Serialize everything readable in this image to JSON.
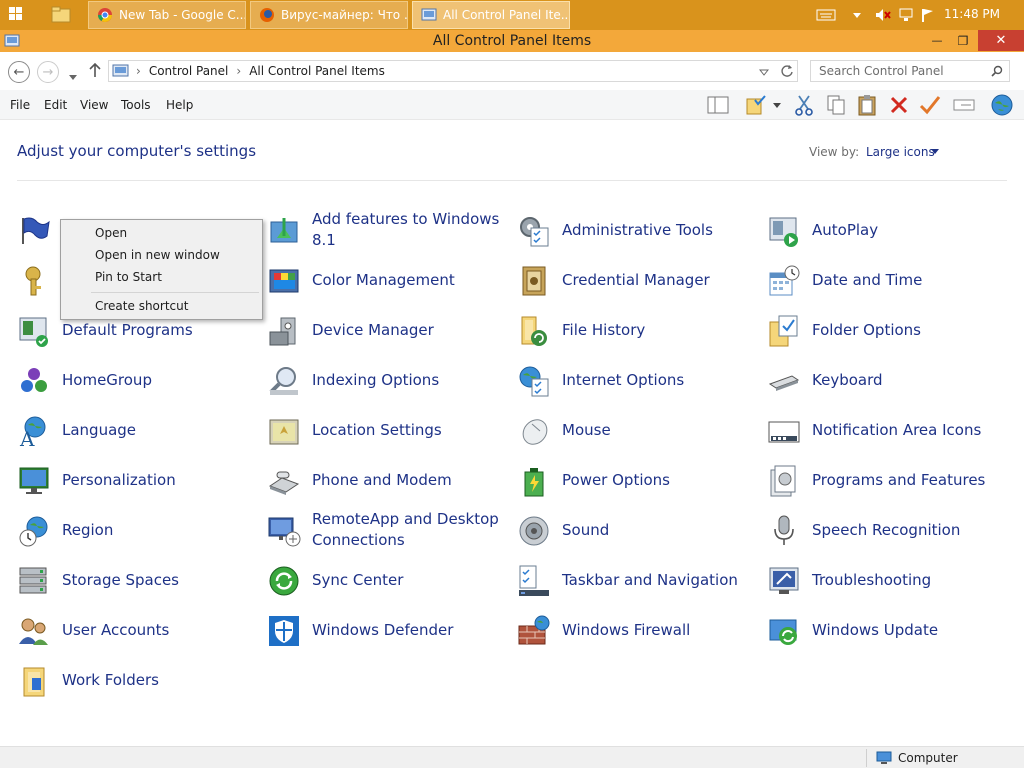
{
  "taskbar": {
    "tabs": [
      {
        "label": "New Tab - Google C...",
        "icon": "chrome-icon"
      },
      {
        "label": "Вирус-майнер: Что ...",
        "icon": "firefox-icon"
      },
      {
        "label": "All Control Panel Ite...",
        "icon": "control-panel-icon"
      }
    ],
    "clock": "11:48 PM"
  },
  "window": {
    "title": "All Control Panel Items",
    "close_glyph": "✕",
    "maximize_glyph": "❐",
    "minimize_glyph": "—"
  },
  "address": {
    "crumb1": "Control Panel",
    "crumb2": "All Control Panel Items",
    "separator": "›",
    "search_placeholder": "Search Control Panel"
  },
  "menu": {
    "file": "File",
    "edit": "Edit",
    "view": "View",
    "tools": "Tools",
    "help": "Help"
  },
  "content": {
    "heading": "Adjust your computer's settings",
    "view_by_label": "View by:",
    "view_by_value": "Large icons"
  },
  "items": [
    {
      "label": "",
      "icon": "flag-icon"
    },
    {
      "label": "Add features to Windows 8.1",
      "icon": "add-features-icon"
    },
    {
      "label": "Administrative Tools",
      "icon": "admin-tools-icon"
    },
    {
      "label": "AutoPlay",
      "icon": "autoplay-icon"
    },
    {
      "label": "",
      "icon": "keys-icon"
    },
    {
      "label": "Color Management",
      "icon": "color-management-icon"
    },
    {
      "label": "Credential Manager",
      "icon": "credential-manager-icon"
    },
    {
      "label": "Date and Time",
      "icon": "date-time-icon"
    },
    {
      "label": "Default Programs",
      "icon": "default-programs-icon"
    },
    {
      "label": "Device Manager",
      "icon": "device-manager-icon"
    },
    {
      "label": "File History",
      "icon": "file-history-icon"
    },
    {
      "label": "Folder Options",
      "icon": "folder-options-icon"
    },
    {
      "label": "HomeGroup",
      "icon": "homegroup-icon"
    },
    {
      "label": "Indexing Options",
      "icon": "indexing-options-icon"
    },
    {
      "label": "Internet Options",
      "icon": "internet-options-icon"
    },
    {
      "label": "Keyboard",
      "icon": "keyboard-icon"
    },
    {
      "label": "Language",
      "icon": "language-icon"
    },
    {
      "label": "Location Settings",
      "icon": "location-settings-icon"
    },
    {
      "label": "Mouse",
      "icon": "mouse-icon"
    },
    {
      "label": "Notification Area Icons",
      "icon": "notification-area-icon"
    },
    {
      "label": "Personalization",
      "icon": "personalization-icon"
    },
    {
      "label": "Phone and Modem",
      "icon": "phone-modem-icon"
    },
    {
      "label": "Power Options",
      "icon": "power-options-icon"
    },
    {
      "label": "Programs and Features",
      "icon": "programs-features-icon"
    },
    {
      "label": "Region",
      "icon": "region-icon"
    },
    {
      "label": "RemoteApp and Desktop Connections",
      "icon": "remoteapp-icon"
    },
    {
      "label": "Sound",
      "icon": "sound-icon"
    },
    {
      "label": "Speech Recognition",
      "icon": "speech-recognition-icon"
    },
    {
      "label": "Storage Spaces",
      "icon": "storage-spaces-icon"
    },
    {
      "label": "Sync Center",
      "icon": "sync-center-icon"
    },
    {
      "label": "Taskbar and Navigation",
      "icon": "taskbar-navigation-icon"
    },
    {
      "label": "Troubleshooting",
      "icon": "troubleshooting-icon"
    },
    {
      "label": "User Accounts",
      "icon": "user-accounts-icon"
    },
    {
      "label": "Windows Defender",
      "icon": "windows-defender-icon"
    },
    {
      "label": "Windows Firewall",
      "icon": "windows-firewall-icon"
    },
    {
      "label": "Windows Update",
      "icon": "windows-update-icon"
    },
    {
      "label": "Work Folders",
      "icon": "work-folders-icon"
    }
  ],
  "context_menu": {
    "open": "Open",
    "open_new_window": "Open in new window",
    "pin_to_start": "Pin to Start",
    "create_shortcut": "Create shortcut"
  },
  "status": {
    "location": "Computer"
  },
  "colors": {
    "taskbar": "#d9931c",
    "titlebar": "#f3a83a",
    "link": "#1e3287",
    "close": "#c84031"
  }
}
